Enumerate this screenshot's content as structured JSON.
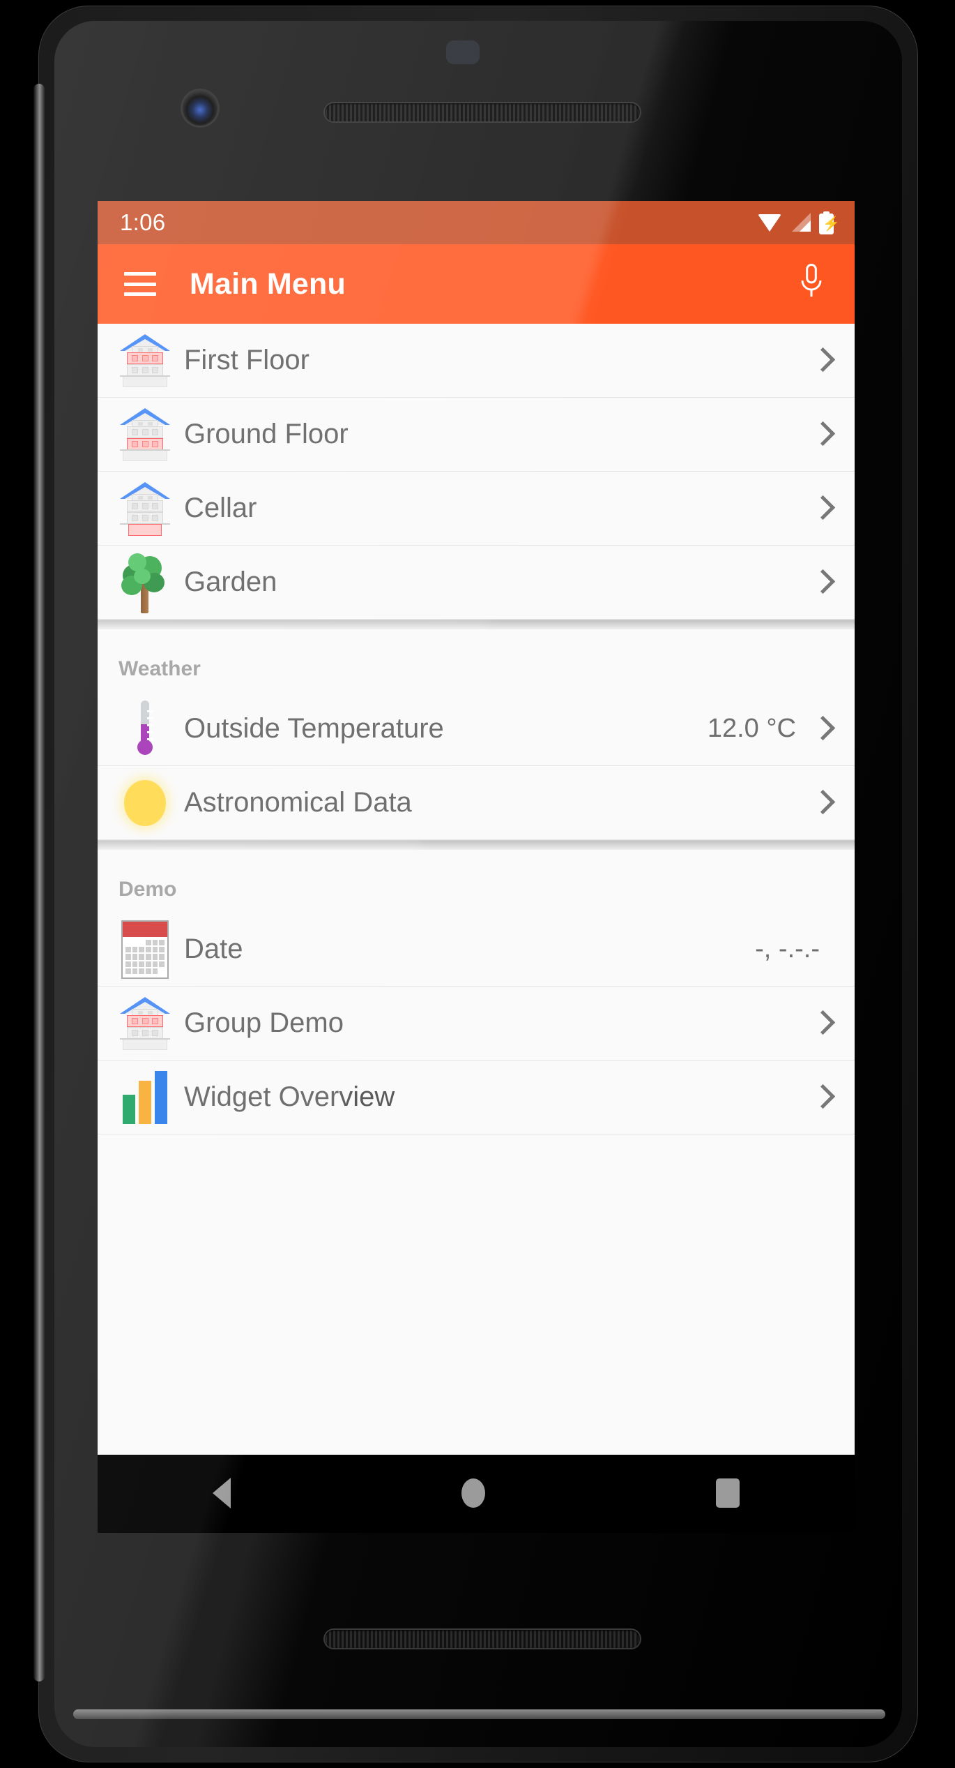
{
  "status_bar": {
    "time": "1:06",
    "icons": [
      "wifi-icon",
      "cellular-signal-icon",
      "battery-charging-icon"
    ]
  },
  "app_bar": {
    "menu_icon": "hamburger-menu-icon",
    "title": "Main Menu",
    "action_icon": "microphone-icon"
  },
  "colors": {
    "status_bar": "#C7512A",
    "app_bar": "#FF5722",
    "screen_bg": "#FAFAFA",
    "label_text": "#5A5A5A",
    "section_header": "#9A9A9A",
    "chevron": "#777777",
    "thermometer_accent": "#9C27B0",
    "sun_accent": "#FFD740",
    "calendar_accent": "#D32F2F",
    "bar_green": "#0F9D58",
    "bar_orange": "#F9A825",
    "bar_blue": "#1A73E8"
  },
  "sections": [
    {
      "header": null,
      "rows": [
        {
          "label": "First Floor",
          "value": null,
          "icon": "house-first-floor-icon",
          "chevron": true
        },
        {
          "label": "Ground Floor",
          "value": null,
          "icon": "house-ground-floor-icon",
          "chevron": true
        },
        {
          "label": "Cellar",
          "value": null,
          "icon": "house-cellar-icon",
          "chevron": true
        },
        {
          "label": "Garden",
          "value": null,
          "icon": "tree-icon",
          "chevron": true
        }
      ]
    },
    {
      "header": "Weather",
      "rows": [
        {
          "label": "Outside Temperature",
          "value": "12.0 °C",
          "icon": "thermometer-icon",
          "chevron": true
        },
        {
          "label": "Astronomical Data",
          "value": null,
          "icon": "sun-icon",
          "chevron": true
        }
      ]
    },
    {
      "header": "Demo",
      "rows": [
        {
          "label": "Date",
          "value": "-, -.-.-",
          "icon": "calendar-icon",
          "chevron": false
        },
        {
          "label": "Group Demo",
          "value": null,
          "icon": "house-first-floor-icon",
          "chevron": true
        },
        {
          "label": "Widget Overview",
          "value": null,
          "icon": "bar-chart-icon",
          "chevron": true
        }
      ]
    }
  ],
  "nav_bar": {
    "back": "back-triangle-icon",
    "home": "home-circle-icon",
    "recents": "recents-square-icon"
  }
}
